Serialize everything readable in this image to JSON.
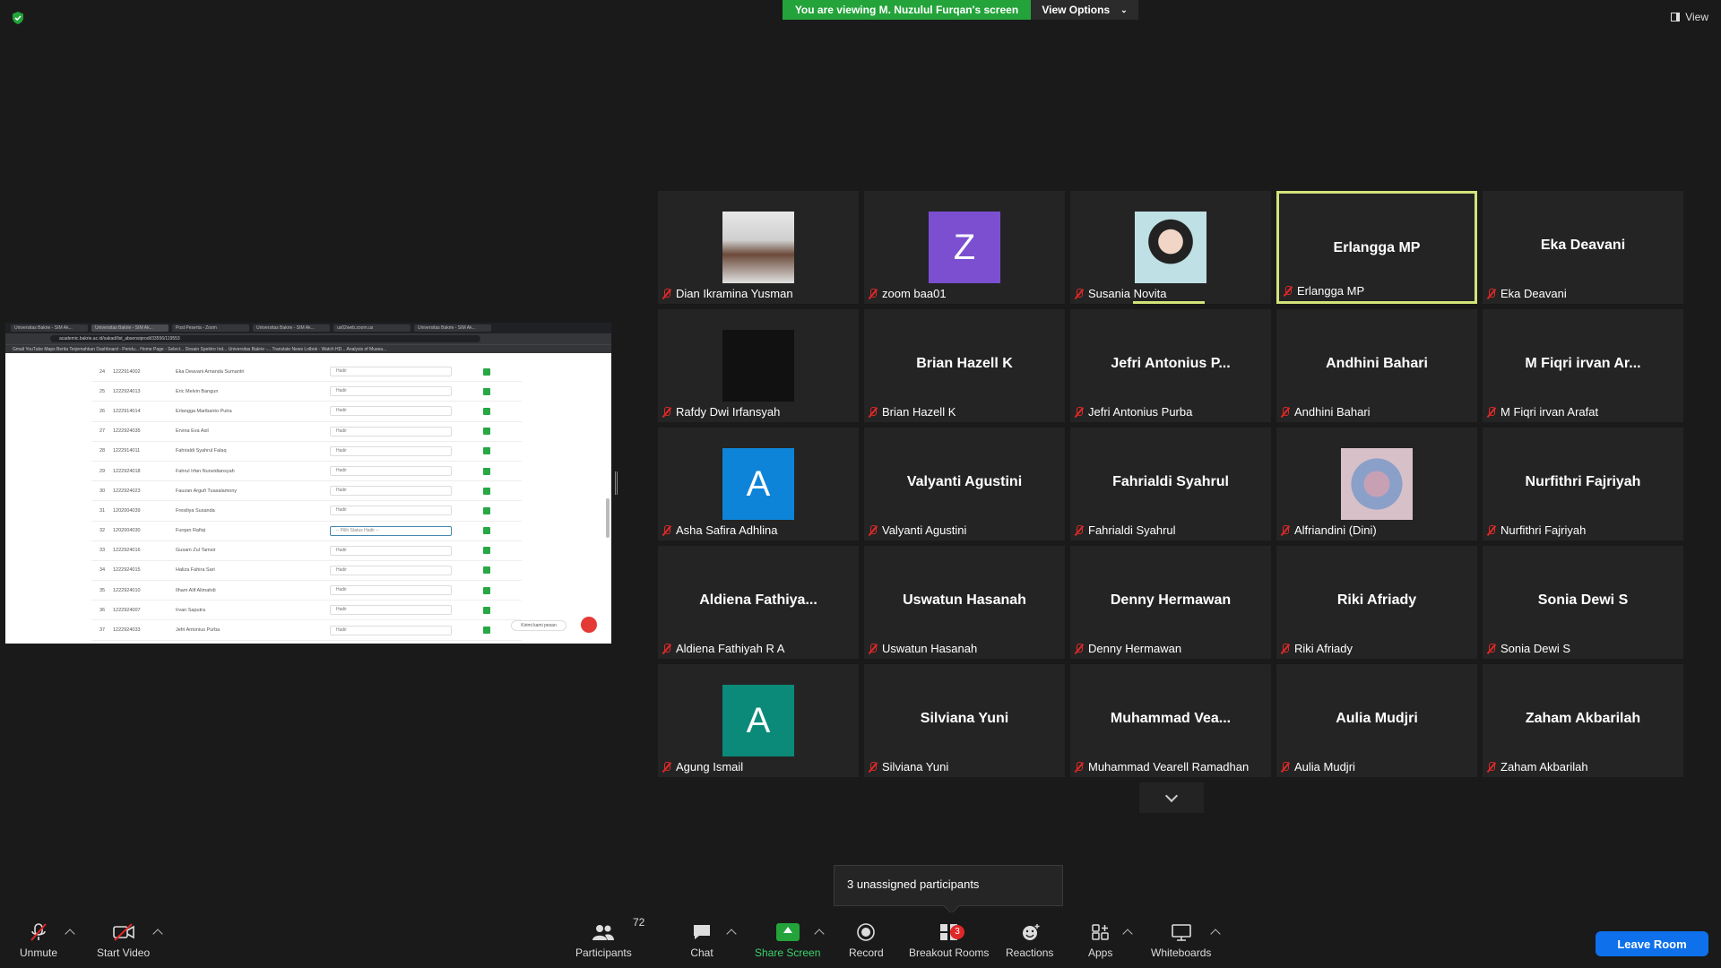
{
  "banner": {
    "viewing_text": "You are viewing M. Nuzulul Furqan's screen",
    "view_options_label": "View Options",
    "view_label": "View"
  },
  "shared_screen": {
    "tabs": [
      "Universitas Bakrie - SIM Ak...",
      "Universitas Bakrie - SIM Ak...",
      "Post Peserta - Zoom",
      "Universitas Bakrie - SIM Ak...",
      "us02web.zoom.us",
      "Universitas Bakrie - SIM Ak..."
    ],
    "url": "academic.bakrie.ac.id/sakad/list_absensiprodi/33556/119553",
    "bookmarks": "Gmail   YouTube   Maps   Berita   Terjemahkan   Dashboard - Pendu...   Home Page - Select...   Desain Spektro Ind...   Universitas Bakrie -...   Translate   News   Lolbok - Watch HD...   Analysis of Musea...",
    "rows": [
      {
        "no": "24",
        "nim": "1222914002",
        "name": "Eka Deavani Amanda Sumantri",
        "status": "Hadir"
      },
      {
        "no": "25",
        "nim": "1222924013",
        "name": "Eric Melvin Bangun",
        "status": "Hadir"
      },
      {
        "no": "26",
        "nim": "1222914014",
        "name": "Erlangga Maribanto Putra",
        "status": "Hadir"
      },
      {
        "no": "27",
        "nim": "1222924035",
        "name": "Ervina Eva Asil",
        "status": "Hadir"
      },
      {
        "no": "28",
        "nim": "1222914011",
        "name": "Fahrialdi Syahrul Falaq",
        "status": "Hadir"
      },
      {
        "no": "29",
        "nim": "1222924018",
        "name": "Fahrul Irfan Nurwidiansyah",
        "status": "Hadir"
      },
      {
        "no": "30",
        "nim": "1222924023",
        "name": "Fauzan Argufi Tuasalamony",
        "status": "Hadir"
      },
      {
        "no": "31",
        "nim": "1202004039",
        "name": "Fresiliya Susanda",
        "status": "Hadir"
      },
      {
        "no": "32",
        "nim": "1202004030",
        "name": "Furqan Rafiqi",
        "status": "-- Pilih Status Hadir --"
      },
      {
        "no": "33",
        "nim": "1222924016",
        "name": "Gusam Zul Tamsir",
        "status": "Hadir"
      },
      {
        "no": "34",
        "nim": "1222924015",
        "name": "Haliza Fahira Sari",
        "status": "Hadir"
      },
      {
        "no": "35",
        "nim": "1222924010",
        "name": "Ilham Alif Alimahdi",
        "status": "Hadir"
      },
      {
        "no": "36",
        "nim": "1222924007",
        "name": "Irvan Saputra",
        "status": "Hadir"
      },
      {
        "no": "37",
        "nim": "1222924033",
        "name": "Jefri Antonius Purba",
        "status": "Hadir"
      }
    ],
    "chat_label": "Kirimi kami pesan"
  },
  "participants": [
    {
      "tile_name": "",
      "name": "Dian Ikramina Yusman",
      "avatar": "photo",
      "photo": "a"
    },
    {
      "tile_name": "",
      "name": "zoom baa01",
      "avatar": "Z",
      "color": "#7b4fd0"
    },
    {
      "tile_name": "",
      "name": "Susania Novita",
      "avatar": "photo",
      "photo": "b"
    },
    {
      "tile_name": "Erlangga MP",
      "name": "Erlangga MP",
      "active": true
    },
    {
      "tile_name": "Eka Deavani",
      "name": "Eka Deavani"
    },
    {
      "tile_name": "",
      "name": "Rafdy Dwi Irfansyah",
      "avatar": "photo",
      "photo": "logo"
    },
    {
      "tile_name": "Brian Hazell K",
      "name": "Brian Hazell K"
    },
    {
      "tile_name": "Jefri Antonius P...",
      "name": "Jefri Antonius Purba"
    },
    {
      "tile_name": "Andhini Bahari",
      "name": "Andhini Bahari"
    },
    {
      "tile_name": "M Fiqri irvan Ar...",
      "name": "M Fiqri irvan Arafat"
    },
    {
      "tile_name": "",
      "name": "Asha Safira Adhlina",
      "avatar": "A",
      "color": "#0e84d8"
    },
    {
      "tile_name": "Valyanti Agustini",
      "name": "Valyanti Agustini"
    },
    {
      "tile_name": "Fahrialdi Syahrul",
      "name": "Fahrialdi Syahrul"
    },
    {
      "tile_name": "",
      "name": "Alfriandini (Dini)",
      "avatar": "photo",
      "photo": "c"
    },
    {
      "tile_name": "Nurfithri Fajriyah",
      "name": "Nurfithri Fajriyah"
    },
    {
      "tile_name": "Aldiena  Fathiya...",
      "name": "Aldiena Fathiyah R A"
    },
    {
      "tile_name": "Uswatun Hasanah",
      "name": "Uswatun Hasanah"
    },
    {
      "tile_name": "Denny Hermawan",
      "name": "Denny Hermawan"
    },
    {
      "tile_name": "Riki Afriady",
      "name": "Riki Afriady"
    },
    {
      "tile_name": "Sonia Dewi S",
      "name": "Sonia Dewi S"
    },
    {
      "tile_name": "",
      "name": "Agung Ismail",
      "avatar": "A",
      "color": "#0b8a7a"
    },
    {
      "tile_name": "Silviana Yuni",
      "name": "Silviana Yuni"
    },
    {
      "tile_name": "Muhammad  Vea...",
      "name": "Muhammad Vearell Ramadhan"
    },
    {
      "tile_name": "Aulia Mudjri",
      "name": "Aulia Mudjri"
    },
    {
      "tile_name": "Zaham Akbarilah",
      "name": "Zaham Akbarilah"
    }
  ],
  "unassigned_text": "3 unassigned participants",
  "toolbar": {
    "unmute": "Unmute",
    "start_video": "Start Video",
    "participants": "Participants",
    "participants_count": "72",
    "chat": "Chat",
    "share_screen": "Share Screen",
    "record": "Record",
    "breakout_rooms": "Breakout Rooms",
    "breakout_badge": "3",
    "reactions": "Reactions",
    "apps": "Apps",
    "whiteboards": "Whiteboards",
    "leave_room": "Leave Room"
  }
}
